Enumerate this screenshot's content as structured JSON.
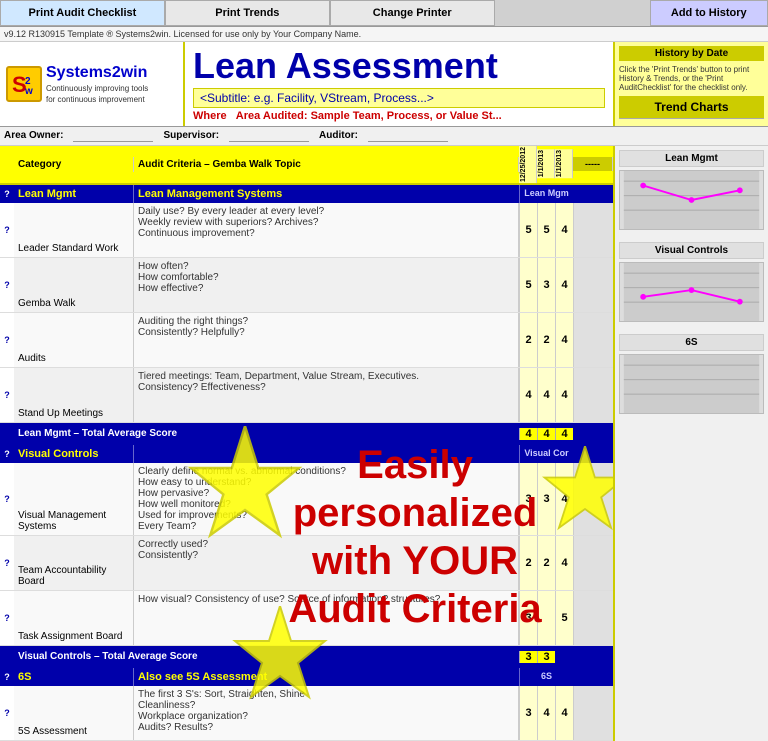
{
  "nav": {
    "print_audit": "Print Audit Checklist",
    "print_trends": "Print Trends",
    "change_printer": "Change Printer",
    "add_history": "Add to History"
  },
  "license": "v9.12 R130915  Template ® Systems2win. Licensed for use only by Your Company Name.",
  "header": {
    "logo_text": "Systems2win",
    "logo_sub1": "Continuously improving tools",
    "logo_sub2": "for continuous improvement",
    "logo_icon": "S",
    "title": "Lean Assessment",
    "subtitle": "<Subtitle: e.g. Facility, VStream, Process...>",
    "where_label": "Where",
    "area_audited": "Area Audited: Sample Team, Process, or Value St...",
    "area_owner_label": "Area Owner:",
    "supervisor_label": "Supervisor:",
    "auditor_label": "Auditor:"
  },
  "date_panel": {
    "date_label": "Date",
    "history_label": "History by Date",
    "note": "Click the 'Print Trends' button to print History & Trends, or the 'Print AuditChecklist' for the checklist only.",
    "dates": [
      "12/25/2012",
      "1/1/2013",
      "1/1/2013"
    ]
  },
  "trend": {
    "header": "Trend Charts"
  },
  "col_headers": {
    "category": "Category",
    "criteria": "Audit Criteria – Gemba Walk Topic",
    "score": "-----"
  },
  "sections": [
    {
      "id": "lean-mgmt",
      "category": "Lean Mgmt",
      "title": "Lean Management Systems",
      "label": "Lean Mgm",
      "chart_title": "Lean Mgmt",
      "rows": [
        {
          "category": "Leader Standard Work",
          "criteria": "Daily use? By every leader at every level?\nWeekly review with superiors? Archives?\nContinuous improvement?",
          "scores": [
            5,
            5,
            4
          ]
        },
        {
          "category": "Gemba Walk",
          "criteria": "How often?\nHow comfortable?\nHow effective?",
          "scores": [
            5,
            3,
            4
          ]
        },
        {
          "category": "Audits",
          "criteria": "Auditing the right things?\nConsistently? Helpfully?",
          "scores": [
            2,
            2,
            4
          ]
        },
        {
          "category": "Stand Up Meetings",
          "criteria": "Tiered meetings: Team, Department, Value Stream, Executives.\nConsistency? Effectiveness?",
          "scores": [
            4,
            4,
            4
          ]
        }
      ],
      "totals": [
        4,
        4,
        4
      ]
    },
    {
      "id": "visual-controls",
      "category": "Visual Controls",
      "title": "Visual Controls",
      "label": "Visual Cor",
      "chart_title": "Visual Controls",
      "rows": [
        {
          "category": "Visual Management Systems",
          "criteria": "Clearly define normal vs. abnormal conditions?\nHow easy to understand?\nHow pervasive?\nHow well monitored?\nUsed for improvements?\nEvery Team?",
          "scores": [
            3,
            3,
            4
          ]
        },
        {
          "category": "Team Accountability Board",
          "criteria": "Correctly used?\nConsistently?",
          "scores": [
            2,
            2,
            4
          ]
        },
        {
          "category": "Task Assignment Board",
          "criteria": "How visual? Consistency of use? Source of information? structures?",
          "scores": [
            3,
            null,
            5
          ]
        }
      ],
      "totals": [
        3,
        3,
        null
      ]
    },
    {
      "id": "6s",
      "category": "6S",
      "title": "Also see 5S Assessment",
      "label": "6S",
      "chart_title": "6S",
      "rows": [
        {
          "category": "5S Assessment",
          "criteria": "The first 3 S's: Sort, Straighten, Shine\nCleanliness?\nWorkplace organization?\nAudits? Results?",
          "scores": [
            3,
            4,
            4
          ]
        }
      ],
      "totals": []
    }
  ],
  "overlay": {
    "line1": "Easily",
    "line2": "personalized",
    "line3": "with YOUR",
    "line4": "Audit Criteria"
  }
}
